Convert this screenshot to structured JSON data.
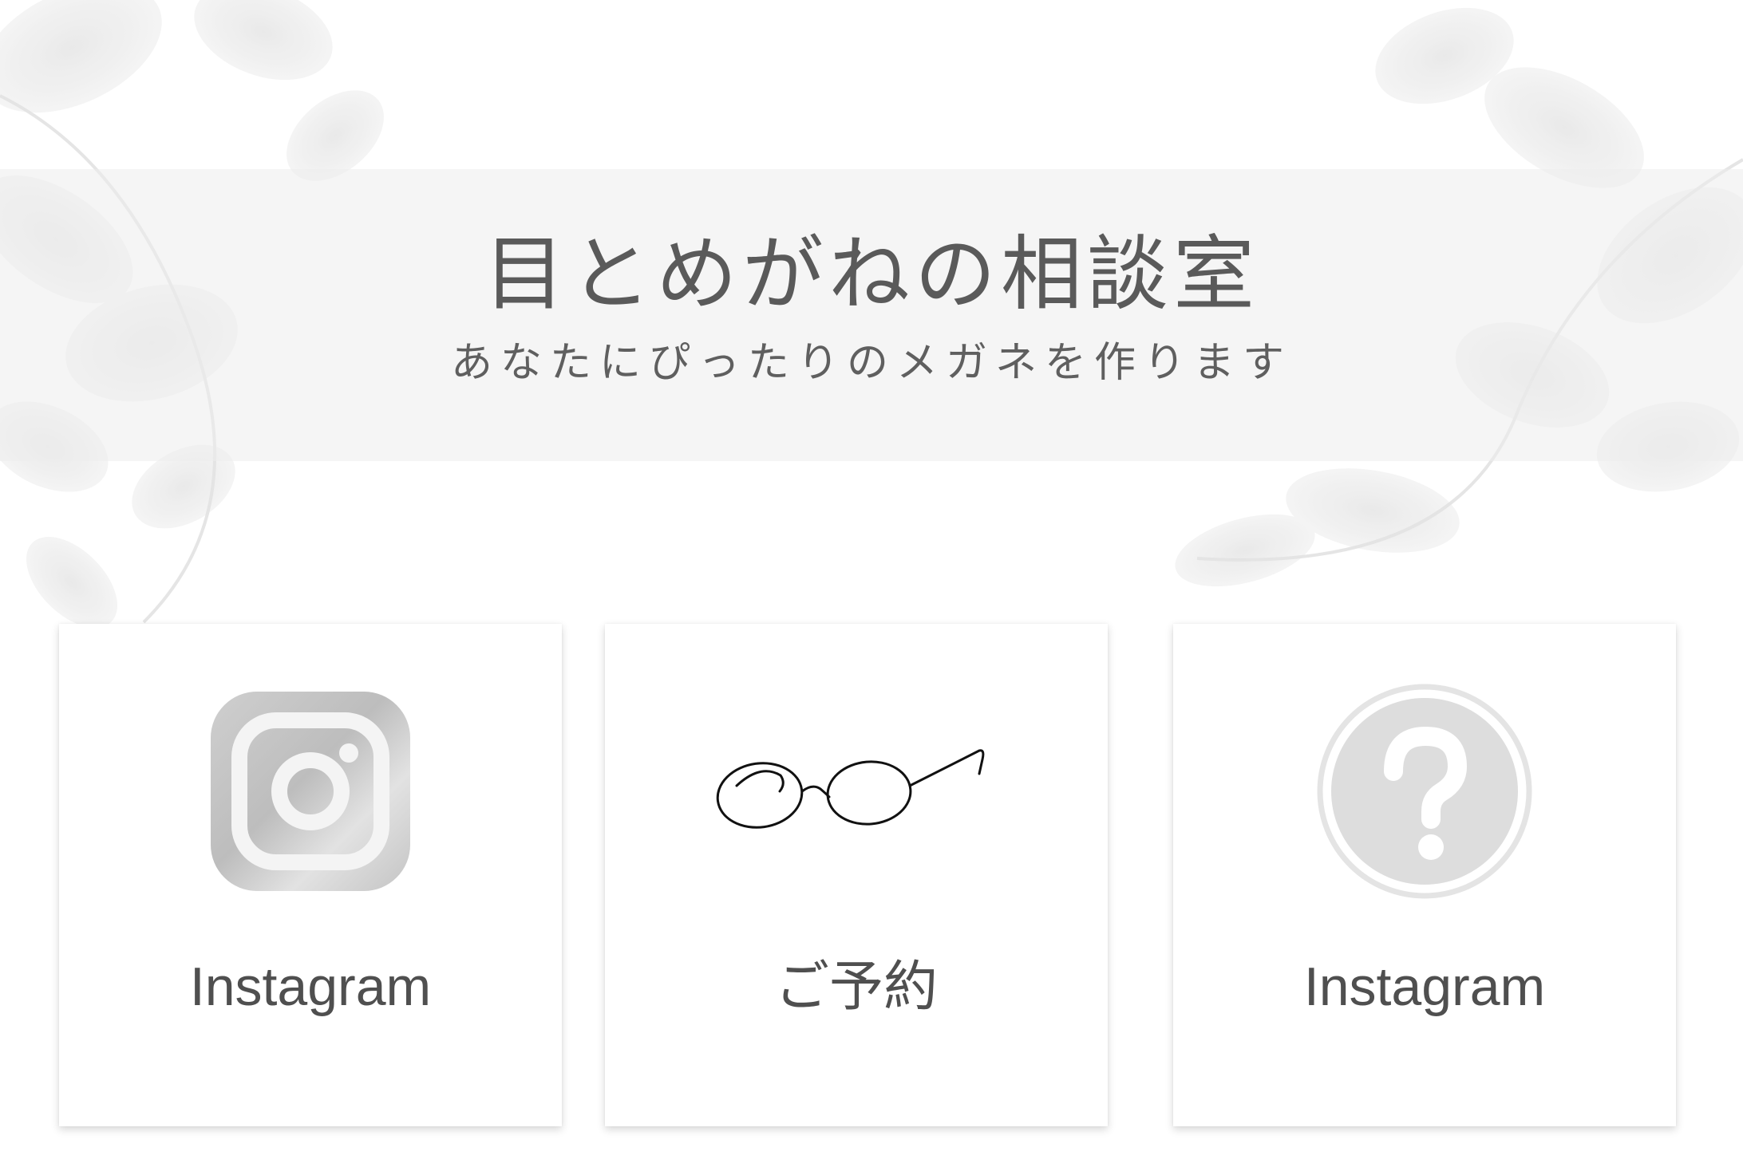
{
  "header": {
    "title": "目とめがねの相談室",
    "subtitle": "あなたにぴったりのメガネを作ります"
  },
  "cards": [
    {
      "label": "Instagram",
      "icon": "instagram-icon"
    },
    {
      "label": "ご予約",
      "icon": "glasses-icon"
    },
    {
      "label": "Instagram",
      "icon": "question-mark-icon"
    }
  ],
  "colors": {
    "banner": "#ececec",
    "text": "#5a5a5a",
    "icon_gray": "#d6d6d6"
  }
}
